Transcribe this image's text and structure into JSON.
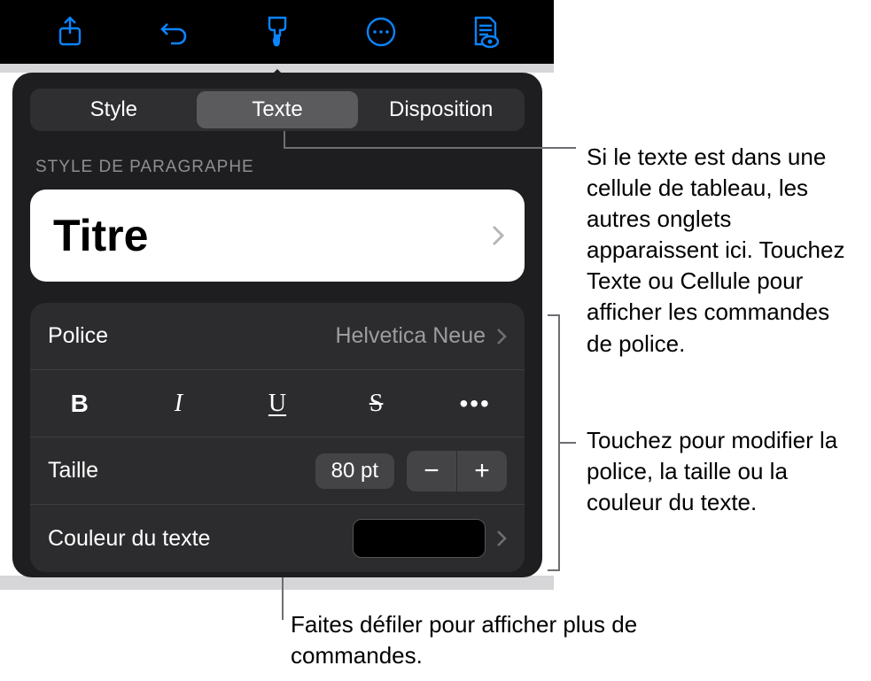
{
  "toolbar": {
    "share_icon": "share-icon",
    "undo_icon": "undo-icon",
    "format_icon": "format-brush-icon",
    "more_icon": "more-ellipsis-icon",
    "view_icon": "view-mode-icon"
  },
  "popover": {
    "tabs": {
      "style": "Style",
      "text": "Texte",
      "layout": "Disposition"
    },
    "section_label": "STYLE DE PARAGRAPHE",
    "paragraph_style": {
      "name": "Titre"
    },
    "font": {
      "label": "Police",
      "value": "Helvetica Neue"
    },
    "format_buttons": {
      "bold": "B",
      "italic": "I",
      "underline": "U",
      "strike": "S",
      "more": "•••"
    },
    "size": {
      "label": "Taille",
      "value": "80 pt",
      "minus": "−",
      "plus": "+"
    },
    "text_color": {
      "label": "Couleur du texte",
      "swatch_hex": "#000000"
    }
  },
  "callouts": {
    "tabs_note": "Si le texte est dans une cellule de tableau, les autres onglets apparaissent ici. Touchez Texte ou Cellule pour afficher les commandes de police.",
    "font_group_note": "Touchez pour modifier la police, la taille ou la couleur du texte.",
    "scroll_note": "Faites défiler pour afficher plus de commandes."
  }
}
